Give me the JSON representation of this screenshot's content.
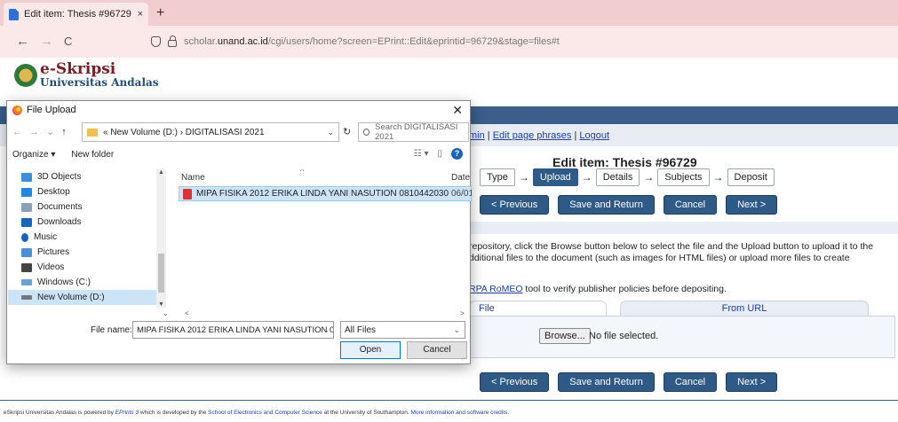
{
  "browser": {
    "tab_title": "Edit item: Thesis #96729 - eSkrip",
    "tab_close": "×",
    "new_tab": "+",
    "back": "←",
    "forward": "→",
    "reload": "C",
    "url_prefix": "scholar.",
    "url_domain": "unand.ac.id",
    "url_rest": "/cgi/users/home?screen=EPrint::Edit&eprintid=96729&stage=files#t"
  },
  "logo": {
    "line1": "e-Skripsi",
    "line2": "Universitas Andalas"
  },
  "usermenu": {
    "prefix": "min",
    "sep1": " | ",
    "edit_phrases": "Edit page phrases",
    "sep2": " | ",
    "logout": "Logout"
  },
  "page": {
    "title": "Edit item: Thesis #96729",
    "stages": [
      {
        "label": "Type"
      },
      {
        "label": "Upload"
      },
      {
        "label": "Details"
      },
      {
        "label": "Subjects"
      },
      {
        "label": "Deposit"
      }
    ],
    "stage_arrow": "→",
    "buttons": {
      "previous": "< Previous",
      "save_return": "Save and Return",
      "cancel": "Cancel",
      "next": "Next >"
    },
    "info_line1": "repository, click the Browse button below to select the file and the Upload button to upload it to the",
    "info_line2": "dditional files to the document (such as images for HTML files) or upload more files to create",
    "sherpa_link": "RPA RoMEO",
    "sherpa_rest": " tool to verify publisher policies before depositing.",
    "tab_file": "File",
    "tab_url": "From URL",
    "browse": "Browse...",
    "no_file": "No file selected."
  },
  "footer": {
    "t1": "eSkripsi Universitas Andalas is powered by ",
    "l1": "EPrints 3",
    "t2": " which is developed by the ",
    "l2": "School of Electronics and Computer Science",
    "t3": " at the University of Southampton. ",
    "l3": "More information and software credits."
  },
  "dialog": {
    "title": "File Upload",
    "close": "✕",
    "nav_back": "←",
    "nav_forward": "→",
    "nav_recent": "⌄",
    "nav_up": "↑",
    "path": "« New Volume (D:)  ›  DIGITALISASI 2021",
    "path_chevron": "⌄",
    "refresh": "↻",
    "search_placeholder": "Search DIGITALISASI 2021",
    "organize": "Organize ▾",
    "new_folder": "New folder",
    "view_icon": "☷ ▾",
    "pane_icon": "▯",
    "help": "?",
    "nav_items": [
      {
        "label": "3D Objects",
        "color": "#3b8ed8"
      },
      {
        "label": "Desktop",
        "color": "#1e88e5"
      },
      {
        "label": "Documents",
        "color": "#8aa0b8"
      },
      {
        "label": "Downloads",
        "color": "#1565c0"
      },
      {
        "label": "Music",
        "color": "#1565c0"
      },
      {
        "label": "Pictures",
        "color": "#4a90d9"
      },
      {
        "label": "Videos",
        "color": "#444"
      },
      {
        "label": "Windows (C:)",
        "color": "#6aa0d8"
      },
      {
        "label": "New Volume (D:)",
        "color": "#777"
      }
    ],
    "col_name": "Name",
    "col_date": "Date m",
    "col_sort": "^",
    "file_name": "MIPA FISIKA 2012 ERIKA LINDA YANI NASUTION 0810442030",
    "file_date": "06/01/",
    "scroll_left": "<",
    "scroll_right": ">",
    "collapse": "⌄",
    "filename_label": "File name:",
    "filename_value": "MIPA FISIKA 2012 ERIKA LINDA YANI NASUTION 0810442",
    "filter_value": "All Files",
    "chevron": "⌄",
    "open": "Open",
    "cancel": "Cancel"
  }
}
